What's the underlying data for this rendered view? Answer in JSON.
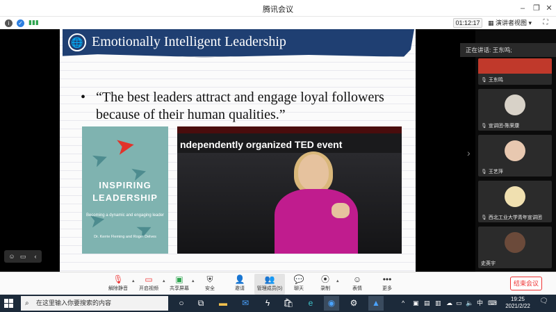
{
  "window": {
    "title": "腾讯会议"
  },
  "infobar": {
    "timer": "01:12:17",
    "view_mode": "演讲者视图"
  },
  "slide": {
    "title": "Emotionally Intelligent Leadership",
    "bullet": "“The best leaders attract and engage loyal followers because of their human qualities.”",
    "book": {
      "title_line1": "INSPIRING",
      "title_line2": "LEADERSHIP",
      "subtitle": "Becoming a dynamic and engaging leader",
      "authors": "Dr. Kerrie Fleming and Roger Delves"
    },
    "photo_caption": "ndependently organized TED event"
  },
  "participants": {
    "speaking_label": "正在讲话: 王东鸣;",
    "tiles": [
      {
        "name": "王东鸣",
        "color": "#c0392b"
      },
      {
        "name": "宣讲团-陈荣康",
        "color": "#d8d2c8"
      },
      {
        "name": "王艺萍",
        "color": "#e8c8b0"
      },
      {
        "name": "西北工业大学青年宣讲团",
        "color": "#f0e0b0"
      },
      {
        "name": "史英宇",
        "color": "#6b4a3a"
      }
    ]
  },
  "toolbar": {
    "buttons": [
      {
        "label": "解除静音",
        "icon": "mic-muted-icon"
      },
      {
        "label": "开启视频",
        "icon": "video-off-icon"
      },
      {
        "label": "共享屏幕",
        "icon": "share-screen-icon"
      },
      {
        "label": "安全",
        "icon": "shield-icon"
      },
      {
        "label": "邀请",
        "icon": "invite-icon"
      },
      {
        "label": "管理成员(5)",
        "icon": "members-icon"
      },
      {
        "label": "聊天",
        "icon": "chat-icon"
      },
      {
        "label": "录制",
        "icon": "record-icon"
      },
      {
        "label": "表情",
        "icon": "emoji-icon"
      },
      {
        "label": "更多",
        "icon": "more-icon"
      }
    ],
    "end_meeting": "结束会议"
  },
  "taskbar": {
    "search_placeholder": "在这里输入你要搜索的内容",
    "ime": "中",
    "time": "19:25",
    "date": "2021/2/22"
  }
}
